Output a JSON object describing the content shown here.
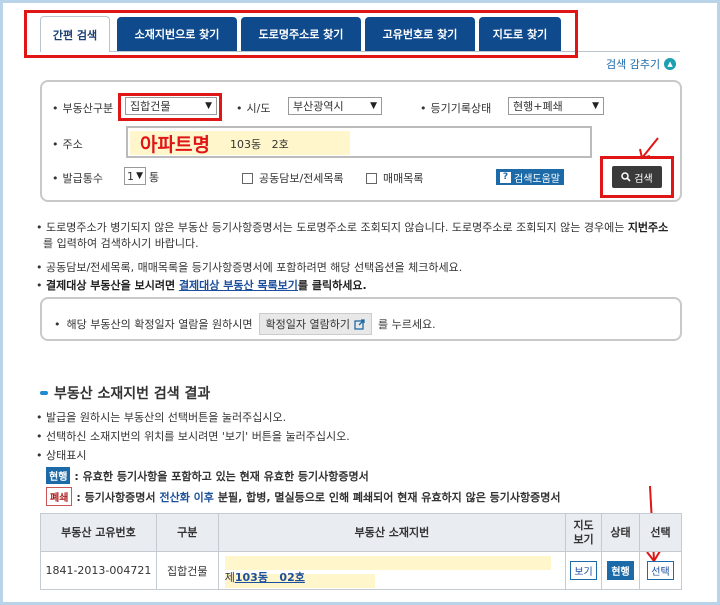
{
  "tabs": [
    {
      "label": "간편 검색",
      "active": true
    },
    {
      "label": "소재지번으로 찾기"
    },
    {
      "label": "도로명주소로 찾기"
    },
    {
      "label": "고유번호로 찾기"
    },
    {
      "label": "지도로 찾기"
    }
  ],
  "toggle_label": "검색 감추기",
  "form": {
    "property_type_label": "부동산구분",
    "property_type_value": "집합건물",
    "city_label": "시/도",
    "city_value": "부산광역시",
    "status_label": "등기기록상태",
    "status_value": "현행+폐쇄",
    "address_label": "주소",
    "address_overlay": "아파트명",
    "address_rest": "103동   2호",
    "count_label": "발급통수",
    "count_value": "1",
    "count_unit": "통",
    "joint_collateral_label": "공동담보/전세목록",
    "sale_list_label": "매매목록",
    "help_label": "검색도움말",
    "search_button": "검색"
  },
  "notes": {
    "n1a": "도로명주소가 병기되지 않은 부동산 등기사항증명서는 도로명주소로 조회되지 않습니다. 도로명주소로 조회되지 않는 경우에는 ",
    "n1b": "지번주소",
    "n1c": "를 입력하여 검색하시기 바랍니다.",
    "n2": "공동담보/전세목록, 매매목록을 등기사항증명서에 포함하려면 해당 선택옵션을 체크하세요.",
    "n3a": "결제대상 부동산을 보시려면 ",
    "n3link": "결제대상 부동산 목록보기",
    "n3b": "를 클릭하세요."
  },
  "infobox": {
    "prefix": "해당 부동산의 확정일자 열람을 원하시면",
    "button": "확정일자 열람하기",
    "suffix": "를 누르세요."
  },
  "results": {
    "title": "부동산 소재지번 검색 결과",
    "b1": "발급을 원하시는 부동산의 선택버튼을 눌러주십시오.",
    "b2": "선택하신 소재지번의 위치를 보시려면 '보기' 버튼을 눌러주십시오.",
    "b3": "상태표시",
    "current_badge": "현행",
    "current_desc": ": 유효한 등기사항을 포함하고 있는 현재 유효한 등기사항증명서",
    "closed_badge": "폐쇄",
    "closed_desc_a": ": 등기사항증명서 ",
    "closed_desc_b": "전산화 이후",
    "closed_desc_c": " 분필, 합병, 멸실등으로 인해 폐쇄되어 현재 유효하지 않은 등기사항증명서"
  },
  "table": {
    "headers": [
      "부동산 고유번호",
      "구분",
      "부동산 소재지번",
      "지도\n보기",
      "상태",
      "선택"
    ],
    "rows": [
      {
        "id": "1841-2013-004721",
        "type": "집합건물",
        "addr_prefix": "제",
        "addr_link": "103동   02호",
        "view": "보기",
        "status": "현행",
        "select": "선택"
      }
    ]
  }
}
